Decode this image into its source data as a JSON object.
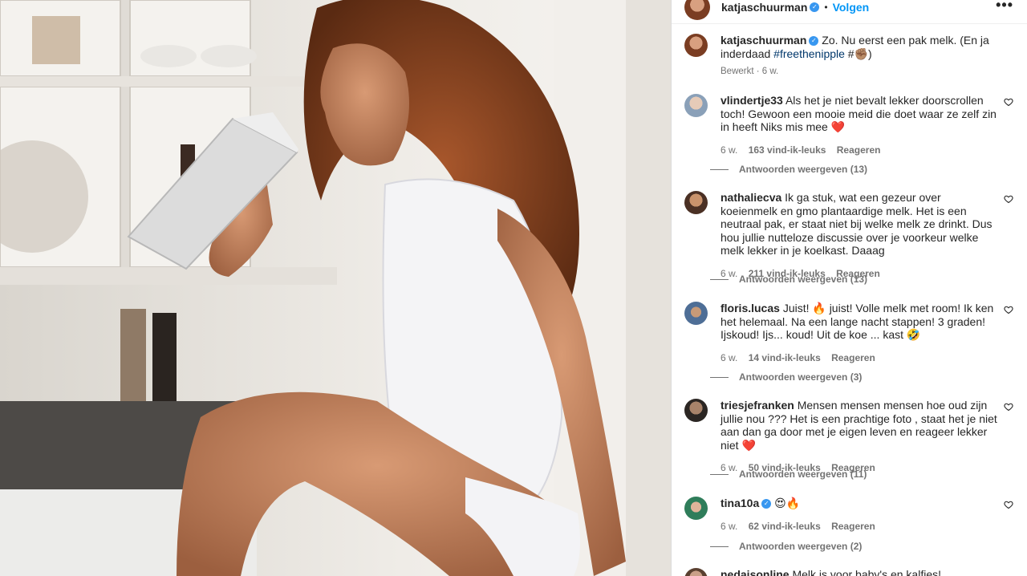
{
  "post": {
    "author": "katjaschuurman",
    "follow_label": "Volgen",
    "more_label": "•••",
    "dot": "•"
  },
  "caption": {
    "author": "katjaschuurman",
    "text": "Zo. Nu eerst een pak melk. (En ja inderdaad ",
    "hashtag": "#freethenipple",
    "text_end": " #✊🏽)",
    "meta": "Bewerkt · 6 w."
  },
  "comments": [
    {
      "user": "vlindertje33",
      "text": "Als het je niet bevalt lekker doorscrollen toch! Gewoon een mooie meid die doet waar ze zelf zin in heeft Niks mis mee ❤️",
      "time": "6 w.",
      "likes": "163 vind-ik-leuks",
      "reply": "Reageren",
      "replies": "Antwoorden weergeven (13)"
    },
    {
      "user": "nathaliecva",
      "text": "Ik ga stuk, wat een gezeur over koeienmelk en gmo plantaardige melk. Het is een neutraal pak, er staat niet bij welke melk ze drinkt. Dus hou jullie nutteloze discussie over je voorkeur welke melk lekker in je koelkast. Daaag",
      "time": "6 w.",
      "likes": "211 vind-ik-leuks",
      "reply": "Reageren",
      "replies": "Antwoorden weergeven (13)"
    },
    {
      "user": "floris.lucas",
      "text": "Juist! 🔥 juist! Volle melk met room! Ik ken het helemaal. Na een lange nacht stappen! 3 graden! Ijskoud! Ijs... koud! Uit de koe ... kast 🤣",
      "time": "6 w.",
      "likes": "14 vind-ik-leuks",
      "reply": "Reageren",
      "replies": "Antwoorden weergeven (3)"
    },
    {
      "user": "triesjefranken",
      "text": "Mensen mensen mensen hoe oud zijn jullie nou ??? Het is een prachtige foto , staat het je niet aan dan ga door met je eigen leven en reageer lekker niet ❤️",
      "time": "6 w.",
      "likes": "50 vind-ik-leuks",
      "reply": "Reageren",
      "replies": "Antwoorden weergeven (11)"
    },
    {
      "user": "tina10a",
      "text": "😍🔥",
      "time": "6 w.",
      "likes": "62 vind-ik-leuks",
      "reply": "Reageren",
      "replies": "Antwoorden weergeven (2)"
    },
    {
      "user": "nedaisonline",
      "text": "Melk is voor baby's en kalfjes!"
    }
  ],
  "icons": {
    "verified": "verified-badge-icon",
    "heart": "heart-outline-icon",
    "more": "more-options-icon"
  },
  "colors": {
    "link_blue": "#0095f6",
    "hashtag": "#00376b",
    "meta_gray": "#737373",
    "heart_red": "#ed4956"
  }
}
